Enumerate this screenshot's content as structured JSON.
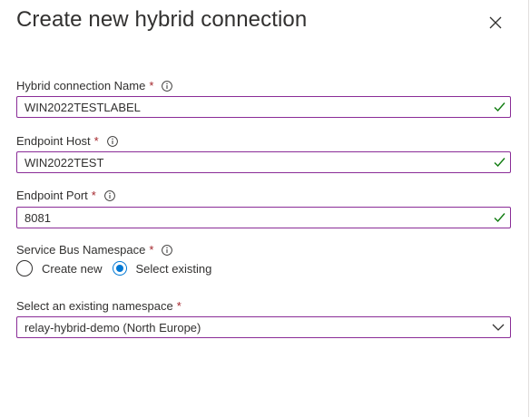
{
  "title": "Create new hybrid connection",
  "colors": {
    "required": "#a4262c",
    "valid": "#107c10",
    "accent": "#0078d4",
    "field_border": "#8a2c97"
  },
  "fields": {
    "connection_name": {
      "label": "Hybrid connection Name",
      "required_mark": "*",
      "value": "WIN2022TESTLABEL",
      "icon": "info-icon",
      "status_icon": "check-icon"
    },
    "endpoint_host": {
      "label": "Endpoint Host",
      "required_mark": "*",
      "value": "WIN2022TEST",
      "icon": "info-icon",
      "status_icon": "check-icon"
    },
    "endpoint_port": {
      "label": "Endpoint Port",
      "required_mark": "*",
      "value": "8081",
      "icon": "info-icon",
      "status_icon": "check-icon"
    }
  },
  "namespace": {
    "label": "Service Bus Namespace",
    "required_mark": "*",
    "options": [
      {
        "label": "Create new",
        "selected": false
      },
      {
        "label": "Select existing",
        "selected": true
      }
    ]
  },
  "existing_namespace": {
    "label": "Select an existing namespace",
    "required_mark": "*",
    "value": "relay-hybrid-demo (North Europe)"
  }
}
